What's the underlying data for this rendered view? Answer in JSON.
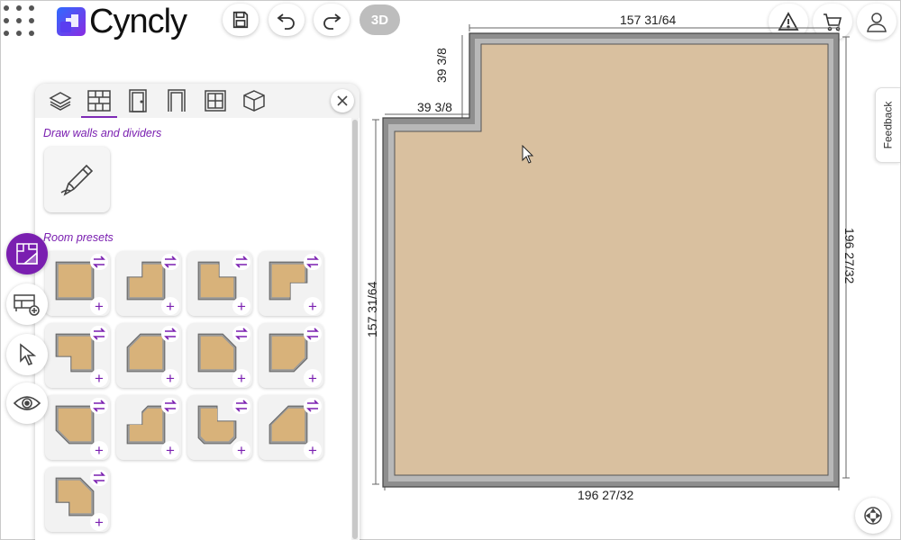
{
  "header": {
    "brand": "Cyncly",
    "view_3d_label": "3D"
  },
  "icons": {
    "apps": "apps-grid-icon",
    "save": "save-icon",
    "undo": "undo-icon",
    "redo": "redo-icon",
    "warning": "warning-icon",
    "cart": "cart-icon",
    "account": "user-icon"
  },
  "feedback": {
    "label": "Feedback"
  },
  "panel": {
    "tabs": [
      {
        "icon": "layers-icon",
        "active": false
      },
      {
        "icon": "brick-wall-icon",
        "active": true
      },
      {
        "icon": "door-icon",
        "active": false
      },
      {
        "icon": "doorway-icon",
        "active": false
      },
      {
        "icon": "window-icon",
        "active": false
      },
      {
        "icon": "cube-icon",
        "active": false
      }
    ],
    "draw_section_title": "Draw walls and dividers",
    "presets_section_title": "Room presets",
    "preset_count": 13
  },
  "side_toolbar": [
    {
      "icon": "floor-plan-icon",
      "active": true
    },
    {
      "icon": "furniture-add-icon",
      "active": false
    },
    {
      "icon": "select-cursor-icon",
      "active": false
    },
    {
      "icon": "visibility-eye-icon",
      "active": false
    }
  ],
  "room": {
    "dimensions": {
      "top": "157 31/64",
      "notch_width": "39 3/8",
      "notch_height": "39 3/8",
      "left": "157 31/64",
      "right": "196 27/32",
      "bottom": "196 27/32"
    },
    "floor_color": "#d9c09f",
    "wall_color": "#8e8e8e"
  },
  "colors": {
    "accent": "#7a1fb0",
    "brand_blue": "#3b5bdb"
  }
}
